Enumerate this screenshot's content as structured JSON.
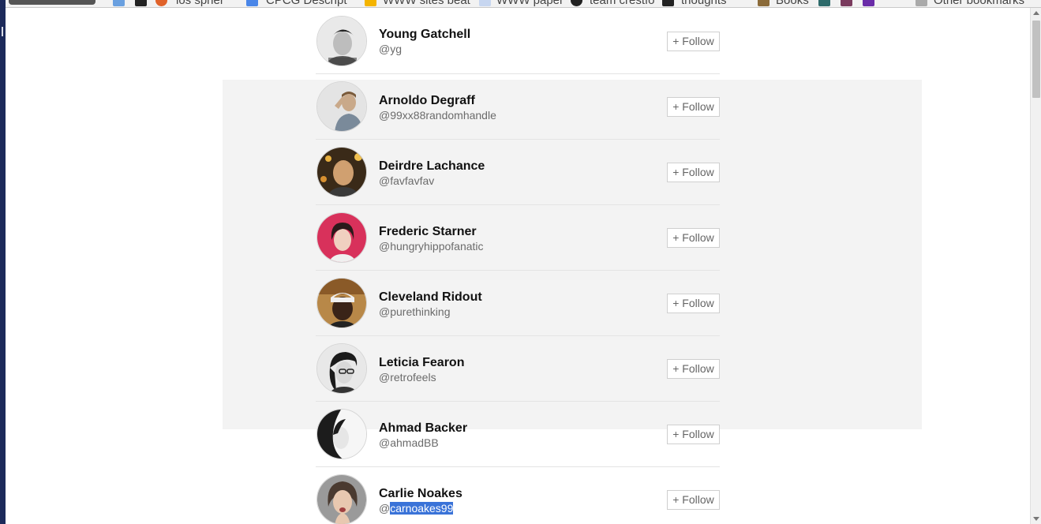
{
  "bookmarks": {
    "items": [
      {
        "label": "ios spher",
        "icon": "red-icon"
      },
      {
        "label": "CPCG Descript",
        "icon": "doc-icon"
      },
      {
        "label": "WWW sites beat",
        "icon": "folder-icon"
      },
      {
        "label": "WWW paper",
        "icon": "gem-icon"
      },
      {
        "label": "team crestfo",
        "icon": "github-icon"
      },
      {
        "label": "thoughts",
        "icon": "notion-icon"
      },
      {
        "label": "Books",
        "icon": "books-icon"
      },
      {
        "label": "Other bookmarks",
        "icon": "folder-icon"
      }
    ]
  },
  "users": [
    {
      "name": "Young Gatchell",
      "handle": "@yg",
      "follow_label": "+ Follow"
    },
    {
      "name": "Arnoldo Degraff",
      "handle": "@99xx88randomhandle",
      "follow_label": "+ Follow"
    },
    {
      "name": "Deirdre Lachance",
      "handle": "@favfavfav",
      "follow_label": "+ Follow"
    },
    {
      "name": "Frederic Starner",
      "handle": "@hungryhippofanatic",
      "follow_label": "+ Follow"
    },
    {
      "name": "Cleveland Ridout",
      "handle": "@purethinking",
      "follow_label": "+ Follow"
    },
    {
      "name": "Leticia Fearon",
      "handle": "@retrofeels",
      "follow_label": "+ Follow"
    },
    {
      "name": "Ahmad Backer",
      "handle": "@ahmadBB",
      "follow_label": "+ Follow"
    },
    {
      "name": "Carlie Noakes",
      "handle_prefix": "@",
      "handle_selected": "carnoakes99",
      "follow_label": "+ Follow"
    }
  ],
  "colors": {
    "highlight_panel": "#f3f3f3",
    "selection": "#3a73d8",
    "window_edge": "#1c2a5a"
  }
}
